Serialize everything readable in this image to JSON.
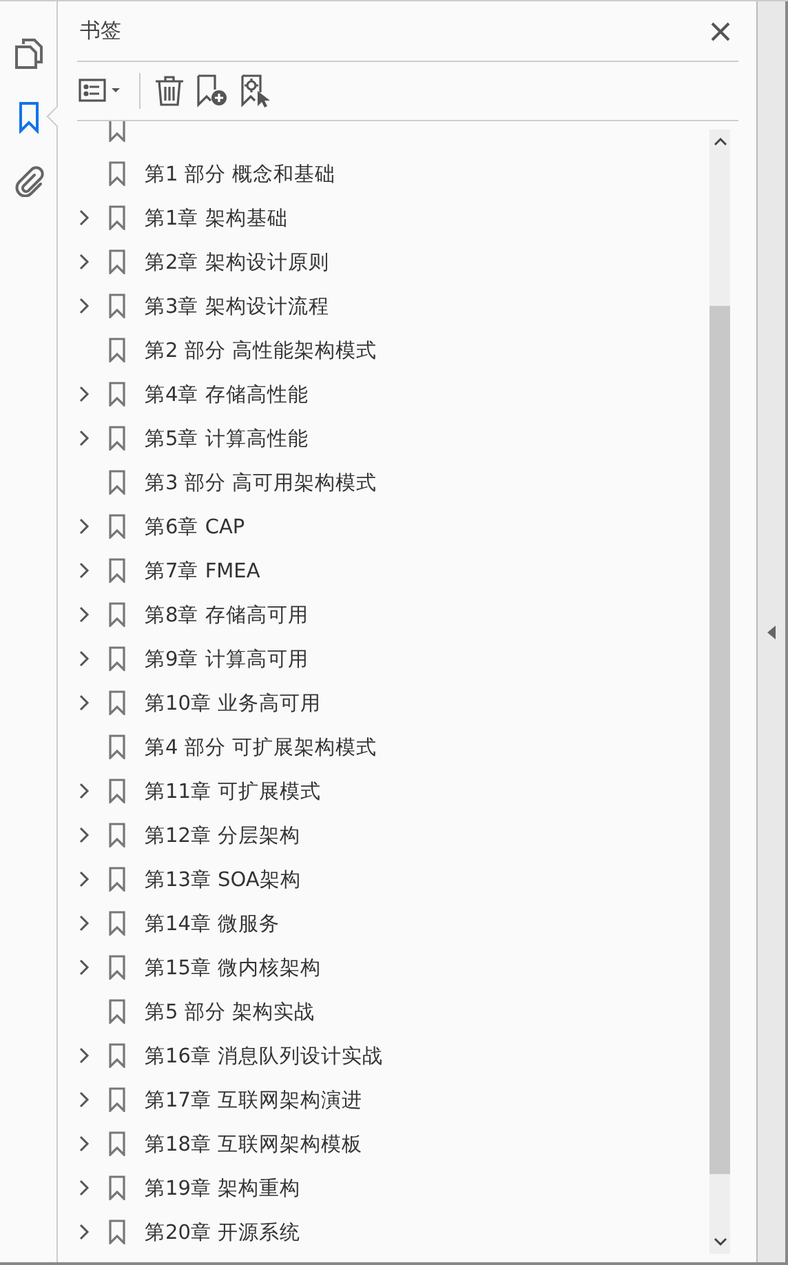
{
  "rail": [
    {
      "kind": "pages",
      "selected": false
    },
    {
      "kind": "bookmarks",
      "selected": true
    },
    {
      "kind": "attachments",
      "selected": false
    }
  ],
  "panel": {
    "title": "书签"
  },
  "bookmarks": [
    {
      "label": "第1 部分 概念和基础",
      "expandable": false
    },
    {
      "label": "第1章 架构基础",
      "expandable": true
    },
    {
      "label": "第2章 架构设计原则",
      "expandable": true
    },
    {
      "label": "第3章 架构设计流程",
      "expandable": true
    },
    {
      "label": "第2 部分 高性能架构模式",
      "expandable": false
    },
    {
      "label": "第4章 存储高性能",
      "expandable": true
    },
    {
      "label": "第5章 计算高性能",
      "expandable": true
    },
    {
      "label": "第3 部分 高可用架构模式",
      "expandable": false
    },
    {
      "label": "第6章 CAP",
      "expandable": true
    },
    {
      "label": "第7章 FMEA",
      "expandable": true
    },
    {
      "label": "第8章 存储高可用",
      "expandable": true
    },
    {
      "label": "第9章 计算高可用",
      "expandable": true
    },
    {
      "label": "第10章 业务高可用",
      "expandable": true
    },
    {
      "label": "第4 部分 可扩展架构模式",
      "expandable": false
    },
    {
      "label": "第11章 可扩展模式",
      "expandable": true
    },
    {
      "label": "第12章 分层架构",
      "expandable": true
    },
    {
      "label": "第13章 SOA架构",
      "expandable": true
    },
    {
      "label": "第14章 微服务",
      "expandable": true
    },
    {
      "label": "第15章 微内核架构",
      "expandable": true
    },
    {
      "label": "第5 部分 架构实战",
      "expandable": false
    },
    {
      "label": "第16章 消息队列设计实战",
      "expandable": true
    },
    {
      "label": "第17章 互联网架构演进",
      "expandable": true
    },
    {
      "label": "第18章 互联网架构模板",
      "expandable": true
    },
    {
      "label": "第19章 架构重构",
      "expandable": true
    },
    {
      "label": "第20章 开源系统",
      "expandable": true
    }
  ]
}
